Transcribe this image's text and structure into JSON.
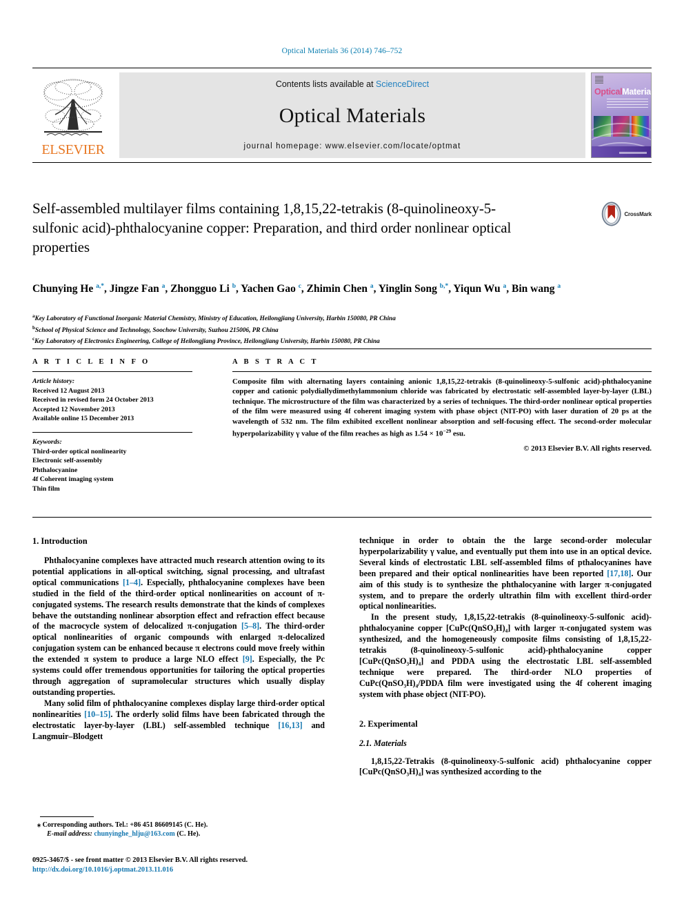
{
  "running_head": "Optical Materials 36 (2014) 746–752",
  "masthead": {
    "contents_prefix": "Contents lists available at ",
    "contents_link": "ScienceDirect",
    "journal_title": "Optical Materials",
    "homepage": "journal homepage: www.elsevier.com/locate/optmat",
    "publisher": "ELSEVIER",
    "cover": {
      "title_part1": "Optical",
      "title_part2": "Materials"
    }
  },
  "title": "Self-assembled multilayer films containing 1,8,15,22-tetrakis (8-quinolineoxy-5-sulfonic acid)-phthalocyanine copper: Preparation, and third order nonlinear optical properties",
  "crossmark_label": "CrossMark",
  "authors_html": "Chunying He <sup>a,*</sup>, Jingze Fan <sup>a</sup>, Zhongguo Li <sup>b</sup>, Yachen Gao <sup>c</sup>, Zhimin Chen <sup>a</sup>, Yinglin Song <sup>b,*</sup>, Yiqun Wu <sup>a</sup>, Bin wang <sup>a</sup>",
  "affiliations": [
    "Key Laboratory of Functional Inorganic Material Chemistry, Ministry of Education, Heilongjiang University, Harbin 150080, PR China",
    "School of Physical Science and Technology, Soochow University, Suzhou 215006, PR China",
    "Key Laboratory of Electronics Engineering, College of Heilongjiang Province, Heilongjiang University, Harbin 150080, PR China"
  ],
  "article_info": {
    "heading": "A R T I C L E   I N F O",
    "history_label": "Article history:",
    "history": [
      "Received 12 August 2013",
      "Received in revised form 24 October 2013",
      "Accepted 12 November 2013",
      "Available online 15 December 2013"
    ],
    "keywords_label": "Keywords:",
    "keywords": [
      "Third-order optical nonlinearity",
      "Electronic self-assembly",
      "Phthalocyanine",
      "4f Coherent imaging system",
      "Thin film"
    ]
  },
  "abstract": {
    "heading": "A B S T R A C T",
    "text": "Composite film with alternating layers containing anionic 1,8,15,22-tetrakis (8-quinolineoxy-5-sulfonic acid)-phthalocyanine copper and cationic polydiallydimethylammonium chloride was fabricated by electrostatic self-assembled layer-by-layer (LBL) technique. The microstructure of the film was characterized by a series of techniques. The third-order nonlinear optical properties of the film were measured using 4f coherent imaging system with phase object (NIT-PO) with laser duration of 20 ps at the wavelength of 532 nm. The film exhibited excellent nonlinear absorption and self-focusing effect. The second-order molecular hyperpolarizability γ value of the film reaches as high as 1.54 × 10",
    "exponent": "−29",
    "text_tail": " esu.",
    "copyright": "© 2013 Elsevier B.V. All rights reserved."
  },
  "sections": {
    "intro_heading": "1. Introduction",
    "intro_p1_a": "Phthalocyanine complexes have attracted much research attention owing to its potential applications in all-optical switching, signal processing, and ultrafast optical communications ",
    "ref_1_4": "[1–4]",
    "intro_p1_b": ". Especially, phthalocyanine complexes have been studied in the field of the third-order optical nonlinearities on account of π-conjugated systems. The research results demonstrate that the kinds of complexes behave the outstanding nonlinear absorption effect and refraction effect because of the macrocycle system of delocalized π-conjugation ",
    "ref_5_8": "[5–8]",
    "intro_p1_c": ". The third-order optical nonlinearities of organic compounds with enlarged π-delocalized conjugation system can be enhanced because π electrons could move freely within the extended π system to produce a large NLO effect ",
    "ref_9": "[9]",
    "intro_p1_d": ". Especially, the Pc systems could offer tremendous opportunities for tailoring the optical properties through aggregation of supramolecular structures which usually display outstanding properties.",
    "intro_p2_a": "Many solid film of phthalocyanine complexes display large third-order optical nonlinearities ",
    "ref_10_15": "[10–15]",
    "intro_p2_b": ". The orderly solid films have been fabricated through the electrostatic layer-by-layer (LBL) self-assembled technique ",
    "ref_16_13": "[16,13]",
    "intro_p2_c": " and Langmuir–Blodgett",
    "right_p1_a": "technique in order to obtain the the large second-order molecular hyperpolarizability γ value, and eventually put them into use in an optical device. Several kinds of electrostatic LBL self-assembled films of pthalocyanines have been prepared and their optical nonlinearities have been reported ",
    "ref_17_18": "[17,18]",
    "right_p1_b": ". Our aim of this study is to synthesize the phthalocyanine with larger π-conjugated system, and to prepare the orderly ultrathin film with excellent third-order optical nonlinearities.",
    "right_p2": "In the present study, 1,8,15,22-tetrakis (8-quinolineoxy-5-sulfonic acid)-phthalocyanine copper [CuPc(QnSO₃H)₄] with larger π-conjugated system was synthesized, and the homogeneously composite films consisting of 1,8,15,22-tetrakis (8-quinolineoxy-5-sulfonic acid)-phthalocyanine copper [CuPc(QnSO₃H)₄] and PDDA using the electrostatic LBL self-assembled technique were prepared. The third-order NLO properties of CuPc(QnSO₃H)₄/PDDA film were investigated using the 4f coherent imaging system with phase object (NIT-PO).",
    "experimental_heading": "2. Experimental",
    "materials_heading": "2.1. Materials",
    "materials_p": "1,8,15,22-Tetrakis (8-quinolineoxy-5-sulfonic acid) phthalocyanine copper [CuPc(QnSO₃H)₄] was synthesized according to the"
  },
  "footnotes": {
    "corresponding": "Corresponding authors. Tel.: +86 451 86609145 (C. He).",
    "email_label": "E-mail address:",
    "email": "chunyinghe_hlju@163.com",
    "email_suffix": "(C. He)."
  },
  "imprint": {
    "line1": "0925-3467/$ - see front matter © 2013 Elsevier B.V. All rights reserved.",
    "doi": "http://dx.doi.org/10.1016/j.optmat.2013.11.016"
  },
  "colors": {
    "link": "#1577b0",
    "elsevier_orange": "#E87722",
    "running_head": "#0b7eb0"
  }
}
